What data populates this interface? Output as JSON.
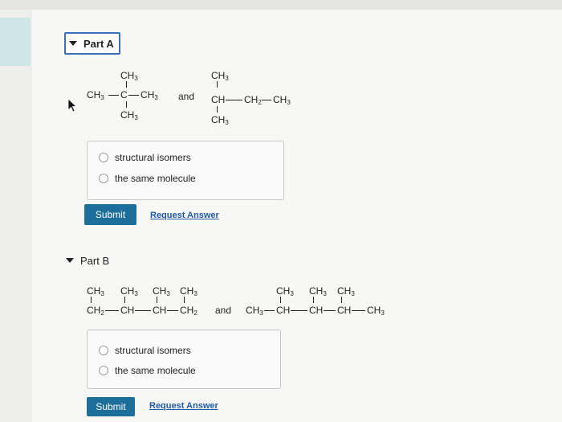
{
  "partA": {
    "title": "Part A",
    "molecule1": {
      "top": "CH3",
      "middle_left": "CH3",
      "middle_center": "C",
      "middle_right": "CH3",
      "bottom": "CH3"
    },
    "conjunction": "and",
    "molecule2": {
      "top": "CH3",
      "main_left": "CH",
      "main_mid": "CH2",
      "main_right": "CH3",
      "bottom": "CH3"
    },
    "options": [
      "structural isomers",
      "the same molecule"
    ],
    "submit_label": "Submit",
    "request_label": "Request Answer"
  },
  "partB": {
    "title": "Part B",
    "molecule1": {
      "tops": [
        "CH3",
        "CH3",
        "CH3",
        "CH3"
      ],
      "chain": [
        "CH2",
        "CH",
        "CH",
        "CH2"
      ]
    },
    "conjunction": "and",
    "molecule2": {
      "tops": [
        "CH3",
        "CH3",
        "CH3"
      ],
      "chain": [
        "CH3",
        "CH",
        "CH",
        "CH",
        "CH3"
      ]
    },
    "options": [
      "structural isomers",
      "the same molecule"
    ],
    "submit_label": "Submit",
    "request_label": "Request Answer"
  },
  "colors": {
    "accent": "#1d6f9a",
    "link": "#1f5aa6",
    "focus_border": "#3b6fb6"
  }
}
